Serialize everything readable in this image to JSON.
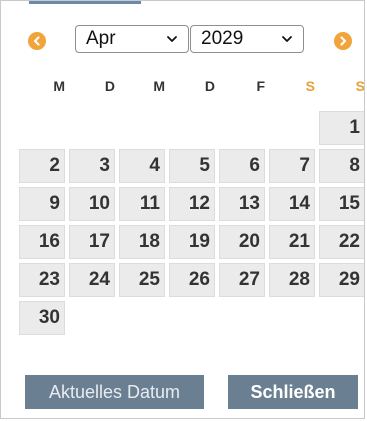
{
  "header": {
    "prev_icon": "chevron-left-circle-icon",
    "next_icon": "chevron-right-circle-icon",
    "month": "Apr",
    "year": "2029",
    "accent_color": "#f0a43a"
  },
  "weekdays": [
    "M",
    "D",
    "M",
    "D",
    "F",
    "S",
    "S"
  ],
  "weekend_color": "#e8a033",
  "days": [
    {
      "label": "1",
      "row": 0,
      "col": 6
    },
    {
      "label": "2",
      "row": 1,
      "col": 0
    },
    {
      "label": "3",
      "row": 1,
      "col": 1
    },
    {
      "label": "4",
      "row": 1,
      "col": 2
    },
    {
      "label": "5",
      "row": 1,
      "col": 3
    },
    {
      "label": "6",
      "row": 1,
      "col": 4
    },
    {
      "label": "7",
      "row": 1,
      "col": 5
    },
    {
      "label": "8",
      "row": 1,
      "col": 6
    },
    {
      "label": "9",
      "row": 2,
      "col": 0
    },
    {
      "label": "10",
      "row": 2,
      "col": 1
    },
    {
      "label": "11",
      "row": 2,
      "col": 2
    },
    {
      "label": "12",
      "row": 2,
      "col": 3
    },
    {
      "label": "13",
      "row": 2,
      "col": 4
    },
    {
      "label": "14",
      "row": 2,
      "col": 5
    },
    {
      "label": "15",
      "row": 2,
      "col": 6
    },
    {
      "label": "16",
      "row": 3,
      "col": 0
    },
    {
      "label": "17",
      "row": 3,
      "col": 1
    },
    {
      "label": "18",
      "row": 3,
      "col": 2
    },
    {
      "label": "19",
      "row": 3,
      "col": 3
    },
    {
      "label": "20",
      "row": 3,
      "col": 4
    },
    {
      "label": "21",
      "row": 3,
      "col": 5
    },
    {
      "label": "22",
      "row": 3,
      "col": 6
    },
    {
      "label": "23",
      "row": 4,
      "col": 0
    },
    {
      "label": "24",
      "row": 4,
      "col": 1
    },
    {
      "label": "25",
      "row": 4,
      "col": 2
    },
    {
      "label": "26",
      "row": 4,
      "col": 3
    },
    {
      "label": "27",
      "row": 4,
      "col": 4
    },
    {
      "label": "28",
      "row": 4,
      "col": 5
    },
    {
      "label": "29",
      "row": 4,
      "col": 6
    },
    {
      "label": "30",
      "row": 5,
      "col": 0
    }
  ],
  "footer": {
    "today_label": "Aktuelles Datum",
    "close_label": "Schließen",
    "button_color": "#6b7f93"
  }
}
